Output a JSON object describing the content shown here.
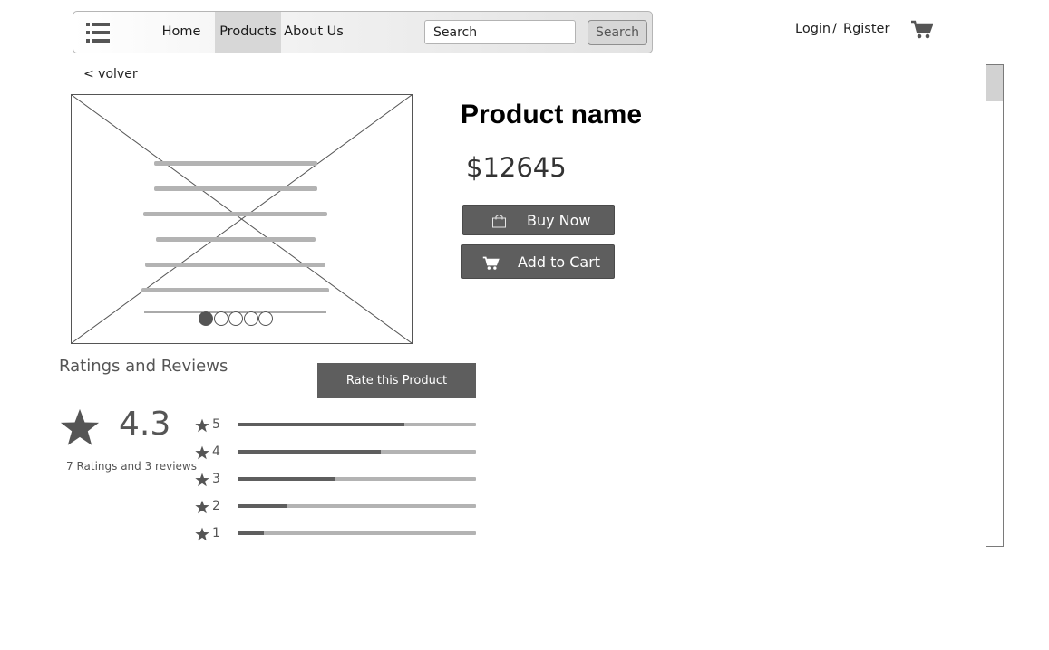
{
  "nav": {
    "menu_icon": "list-menu-icon",
    "links": [
      "Home",
      "Products",
      "About Us"
    ],
    "active": "Products",
    "search": {
      "value": "Search",
      "placeholder": "Search"
    },
    "search_button": "Search"
  },
  "account": {
    "login": "Login",
    "separator": "/",
    "register": "Rgister",
    "cart_icon": "shopping-cart-icon"
  },
  "back_link": "< volver",
  "product": {
    "name": "Product name",
    "price": "$12645",
    "image_dots": 5,
    "image_active_dot": 1,
    "buy_now": "Buy Now",
    "add_to_cart": "Add to Cart"
  },
  "ratings": {
    "title": "Ratings and Reviews",
    "rate_button": "Rate this Product",
    "average": "4.3",
    "summary": "7 Ratings and 3 reviews",
    "rows": [
      {
        "label": "5",
        "fraction": 0.7
      },
      {
        "label": "4",
        "fraction": 0.6
      },
      {
        "label": "3",
        "fraction": 0.41
      },
      {
        "label": "2",
        "fraction": 0.21
      },
      {
        "label": "1",
        "fraction": 0.11
      }
    ]
  },
  "colors": {
    "dark_button": "#5e5e5e",
    "track": "#b3b3b3",
    "active_nav": "#d7d7d7"
  }
}
